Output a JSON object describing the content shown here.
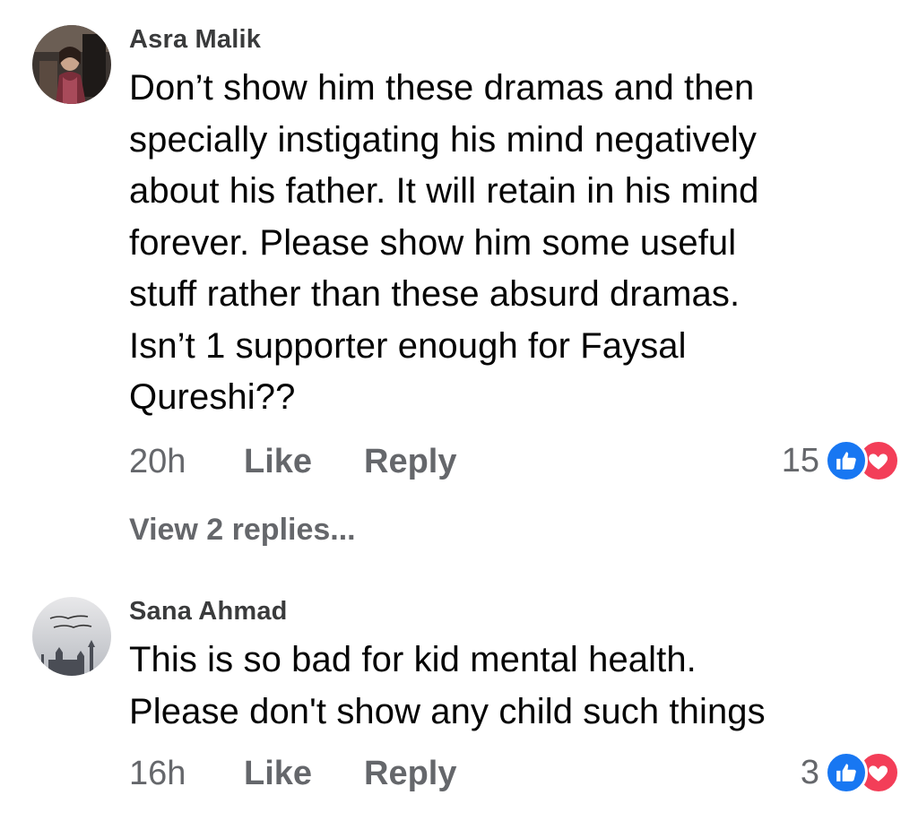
{
  "comments": [
    {
      "author": "Asra Malik",
      "lines": [
        "Don’t show him these dramas and then",
        "specially instigating his mind negatively",
        "about his father. It will retain in his mind",
        "forever. Please show him some useful",
        "stuff rather than these absurd dramas.",
        "Isn’t 1 supporter enough for Faysal",
        "Qureshi??"
      ],
      "time": "20h",
      "like_label": "Like",
      "reply_label": "Reply",
      "reaction_count": "15",
      "reaction_icons": [
        "like-icon",
        "love-icon"
      ],
      "view_replies": "View 2 replies..."
    },
    {
      "author": "Sana Ahmad",
      "lines": [
        "This is so bad for kid mental health.",
        "Please don't show any child such things"
      ],
      "time": "16h",
      "like_label": "Like",
      "reply_label": "Reply",
      "reaction_count": "3",
      "reaction_icons": [
        "like-icon",
        "love-icon"
      ]
    }
  ],
  "colors": {
    "like_blue": "#1877f2",
    "love_red": "#f33e58",
    "secondary_text": "#65676b",
    "primary_text": "#050505"
  }
}
